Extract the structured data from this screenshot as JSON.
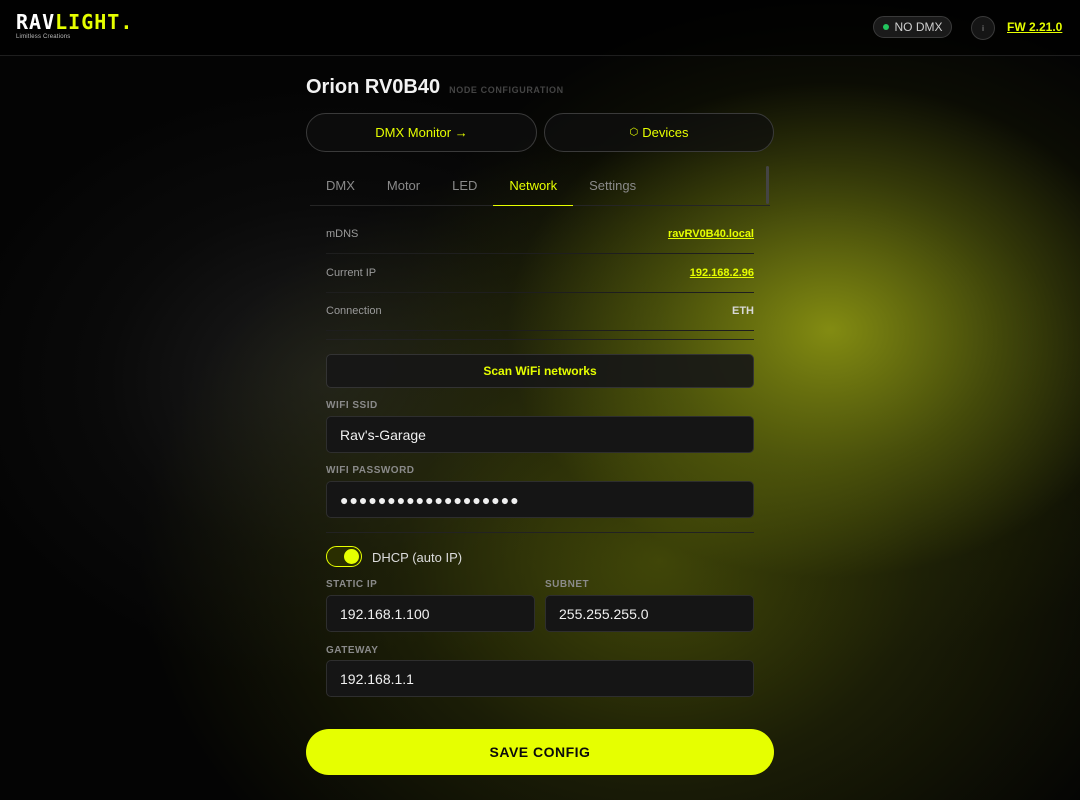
{
  "brand": {
    "logo_part1": "RAV",
    "logo_part2": "LIGHT.",
    "tagline": "Limitless Creations"
  },
  "header": {
    "dmx_status": "NO DMX",
    "info_icon": "i",
    "firmware": "FW 2.21.0"
  },
  "page": {
    "title": "Orion RV0B40",
    "subtitle": "NODE CONFIGURATION"
  },
  "actions": {
    "dmx_monitor": "DMX Monitor →",
    "devices_icon": "⬡",
    "devices": "Devices"
  },
  "tabs": [
    "DMX",
    "Motor",
    "LED",
    "Network",
    "Settings"
  ],
  "active_tab": "Network",
  "network_info": {
    "mdns_label": "mDNS",
    "mdns_value": "ravRV0B40.local",
    "ip_label": "Current IP",
    "ip_value": "192.168.2.96",
    "connection_label": "Connection",
    "connection_value": "ETH"
  },
  "wifi": {
    "scan_label": "Scan WiFi networks",
    "ssid_label": "WIFI SSID",
    "ssid_value": "Rav's-Garage",
    "password_label": "WIFI PASSWORD",
    "password_value": "●●●●●●●●●●●●●●●●●●●"
  },
  "dhcp": {
    "label": "DHCP (auto IP)",
    "enabled": true
  },
  "static": {
    "ip_label": "STATIC IP",
    "ip_value": "192.168.1.100",
    "subnet_label": "SUBNET",
    "subnet_value": "255.255.255.0",
    "gateway_label": "GATEWAY",
    "gateway_value": "192.168.1.1"
  },
  "save_label": "SAVE CONFIG",
  "colors": {
    "accent": "#e6ff00",
    "status_ok": "#22c55e",
    "background": "#040404"
  }
}
